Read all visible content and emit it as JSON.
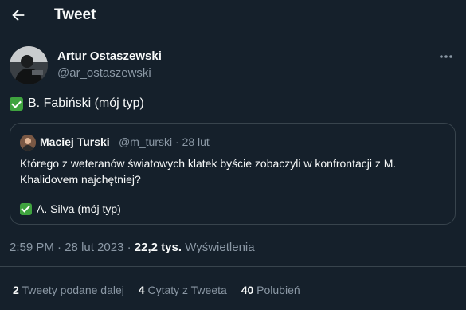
{
  "header": {
    "title": "Tweet"
  },
  "author": {
    "name": "Artur Ostaszewski",
    "handle": "@ar_ostaszewski"
  },
  "tweet": {
    "text": "B. Fabiński (mój typ)"
  },
  "quote": {
    "name": "Maciej Turski",
    "handle": "@m_turski",
    "date": "28 lut",
    "text": "Którego z weteranów światowych klatek byście zobaczyli w konfrontacji z M. Khalidovem najchętniej?",
    "answer": "A. Silva (mój typ)"
  },
  "meta": {
    "time": "2:59 PM",
    "date": "28 lut 2023",
    "views_count": "22,2 tys.",
    "views_label": "Wyświetlenia"
  },
  "stats": {
    "retweets_count": "2",
    "retweets_label": "Tweety podane dalej",
    "quotes_count": "4",
    "quotes_label": "Cytaty z Tweeta",
    "likes_count": "40",
    "likes_label": "Polubień"
  },
  "icons": {
    "back": "arrow-left-icon",
    "more": "more-horizontal-icon",
    "check": "check-mark-emoji"
  },
  "colors": {
    "background": "#15202b",
    "text": "#f7f9f9",
    "secondary": "#8b98a5",
    "border": "#38444d",
    "check_green": "#3fa33f"
  }
}
